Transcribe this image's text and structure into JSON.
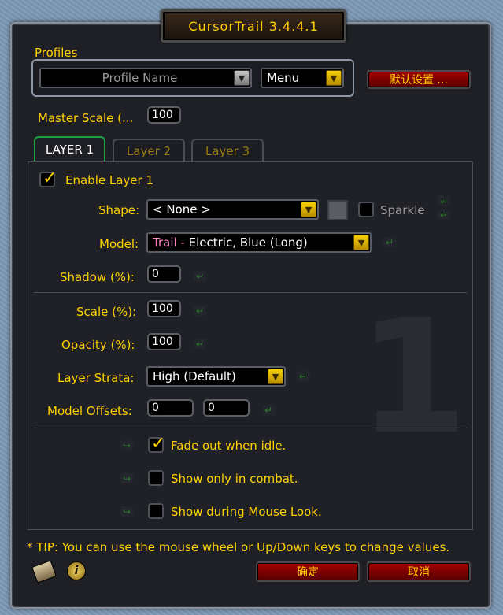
{
  "window": {
    "title": "CursorTrail  3.4.4.1"
  },
  "profiles": {
    "label": "Profiles",
    "profile_name": "Profile Name",
    "menu_label": "Menu",
    "defaults_button": "默认设置 ..."
  },
  "master_scale": {
    "label": "Master Scale (...",
    "value": "100"
  },
  "tabs": [
    {
      "label": "LAYER 1",
      "active": true
    },
    {
      "label": "Layer 2",
      "active": false
    },
    {
      "label": "Layer 3",
      "active": false
    }
  ],
  "layer": {
    "enable_label": "Enable Layer 1",
    "enabled": true,
    "shape_label": "Shape:",
    "shape_value": "< None >",
    "sparkle_label": "Sparkle",
    "model_label": "Model:",
    "model_prefix": "Trail",
    "model_sep": " - ",
    "model_value": "Electric, Blue (Long)",
    "shadow_label": "Shadow (%):",
    "shadow_value": "0",
    "scale_label": "Scale (%):",
    "scale_value": "100",
    "opacity_label": "Opacity (%):",
    "opacity_value": "100",
    "strata_label": "Layer Strata:",
    "strata_value": "High  (Default)",
    "offsets_label": "Model Offsets:",
    "offset_x": "0",
    "offset_y": "0",
    "watermark": "1"
  },
  "options": {
    "fade_label": "Fade out when idle.",
    "fade_checked": true,
    "combat_label": "Show only in combat.",
    "combat_checked": false,
    "mouselook_label": "Show during Mouse Look.",
    "mouselook_checked": false
  },
  "tip": "* TIP: You can use the mouse wheel or Up/Down keys to change values.",
  "footer": {
    "ok_button": "确定",
    "cancel_button": "取消"
  },
  "colors": {
    "gold": "#ffd100",
    "pink": "#ff80c0",
    "tab_active": "#16a34a",
    "red_button": "#8a0000"
  }
}
